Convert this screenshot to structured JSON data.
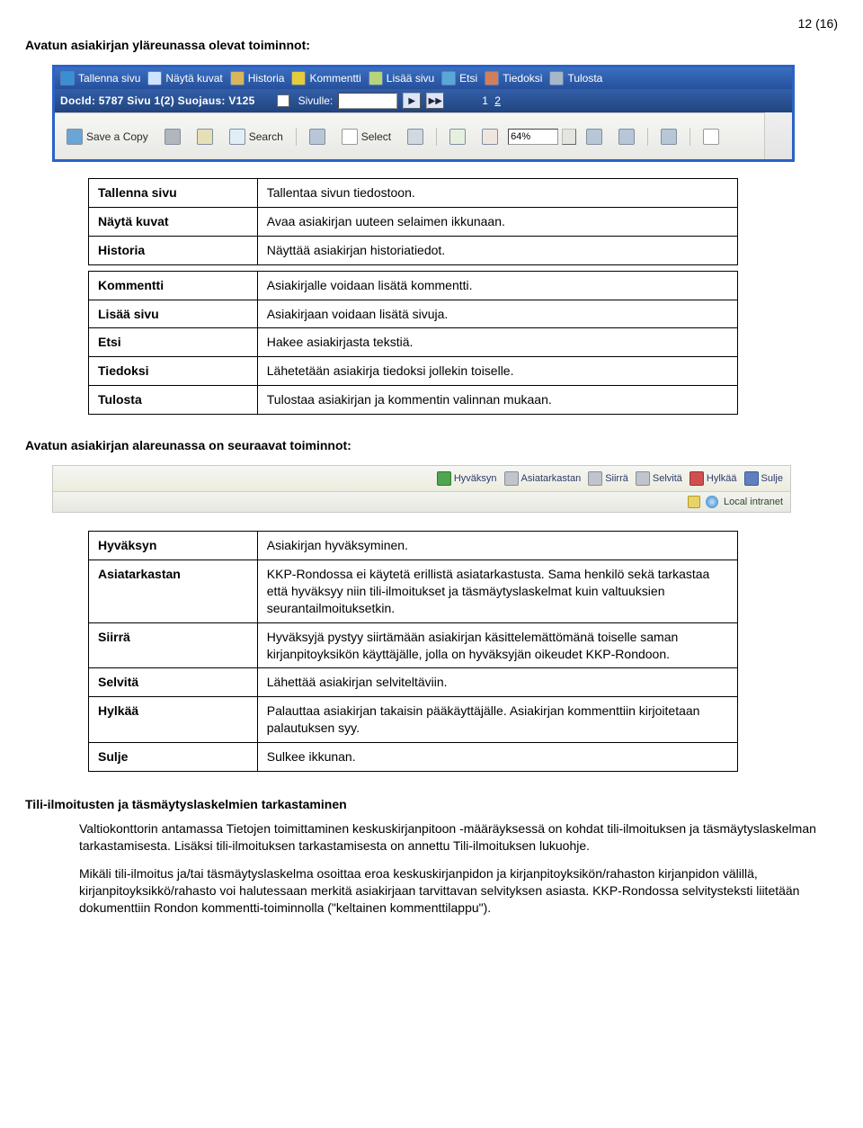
{
  "page_number": "12 (16)",
  "section1_title": "Avatun asiakirjan yläreunassa olevat toiminnot:",
  "top_toolbar": {
    "items": [
      {
        "label": "Tallenna sivu"
      },
      {
        "label": "Näytä kuvat"
      },
      {
        "label": "Historia"
      },
      {
        "label": "Kommentti"
      },
      {
        "label": "Lisää sivu"
      },
      {
        "label": "Etsi"
      },
      {
        "label": "Tiedoksi"
      },
      {
        "label": "Tulosta"
      }
    ],
    "docid_label": "DocId: 5787  Sivu 1(2) Suojaus: V125",
    "sivulle_label": "Sivulle:",
    "sivulle_value": "",
    "page_current": "1",
    "page_other": "2"
  },
  "pdf_toolbar": {
    "save_copy": "Save a Copy",
    "search": "Search",
    "select": "Select",
    "zoom_value": "64%"
  },
  "table_top": {
    "rows_a": [
      {
        "k": "Tallenna sivu",
        "v": "Tallentaa sivun tiedostoon."
      },
      {
        "k": "Näytä kuvat",
        "v": "Avaa asiakirjan uuteen selaimen ikkunaan."
      },
      {
        "k": "Historia",
        "v": "Näyttää asiakirjan historiatiedot."
      }
    ],
    "rows_b": [
      {
        "k": "Kommentti",
        "v": "Asiakirjalle voidaan lisätä kommentti."
      },
      {
        "k": "Lisää sivu",
        "v": "Asiakirjaan voidaan lisätä sivuja."
      },
      {
        "k": "Etsi",
        "v": "Hakee asiakirjasta tekstiä."
      },
      {
        "k": "Tiedoksi",
        "v": "Lähetetään asiakirja tiedoksi jollekin toiselle."
      },
      {
        "k": "Tulosta",
        "v": "Tulostaa asiakirjan ja kommentin valinnan mukaan."
      }
    ]
  },
  "section2_title": "Avatun asiakirjan alareunassa on seuraavat toiminnot:",
  "bottom_toolbar": {
    "items": [
      {
        "label": "Hyväksyn",
        "cls": "green"
      },
      {
        "label": "Asiatarkastan",
        "cls": "gray"
      },
      {
        "label": "Siirrä",
        "cls": "gray"
      },
      {
        "label": "Selvitä",
        "cls": "gray"
      },
      {
        "label": "Hylkää",
        "cls": "red"
      },
      {
        "label": "Sulje",
        "cls": "blue"
      }
    ],
    "zone": "Local intranet"
  },
  "table_bottom": {
    "rows": [
      {
        "k": "Hyväksyn",
        "v": "Asiakirjan hyväksyminen."
      },
      {
        "k": "Asiatarkastan",
        "v": "KKP-Rondossa ei käytetä erillistä asiatarkastusta. Sama henkilö sekä tarkastaa että hyväksyy niin tili-ilmoitukset ja täsmäytyslaskelmat kuin valtuuksien seurantailmoituksetkin."
      },
      {
        "k": "Siirrä",
        "v": "Hyväksyjä pystyy siirtämään asiakirjan käsittelemättömänä toiselle saman kirjanpitoyksikön käyttäjälle, jolla on hyväksyjän oikeudet KKP-Rondoon."
      },
      {
        "k": "Selvitä",
        "v": "Lähettää asiakirjan selviteltäviin."
      },
      {
        "k": "Hylkää",
        "v": "Palauttaa asiakirjan takaisin pääkäyttäjälle. Asiakirjan kommenttiin kirjoitetaan palautuksen syy."
      },
      {
        "k": "Sulje",
        "v": "Sulkee ikkunan."
      }
    ]
  },
  "h3": "Tili-ilmoitusten ja täsmäytyslaskelmien tarkastaminen",
  "para1": "Valtiokonttorin antamassa Tietojen toimittaminen keskuskirjanpitoon -määräyksessä on kohdat tili-ilmoituksen ja täsmäytyslaskelman tarkastamisesta. Lisäksi tili-ilmoituksen tarkastamisesta on annettu Tili-ilmoituksen lukuohje.",
  "para2": "Mikäli tili-ilmoitus ja/tai täsmäytyslaskelma osoittaa eroa keskuskirjanpidon ja kirjanpitoyksikön/rahaston kirjanpidon välillä, kirjanpitoyksikkö/rahasto voi halutessaan merkitä asiakirjaan tarvittavan selvityksen asiasta. KKP-Rondossa selvitysteksti liitetään dokumenttiin Rondon kommentti-toiminnolla (\"keltainen kommenttilappu\")."
}
